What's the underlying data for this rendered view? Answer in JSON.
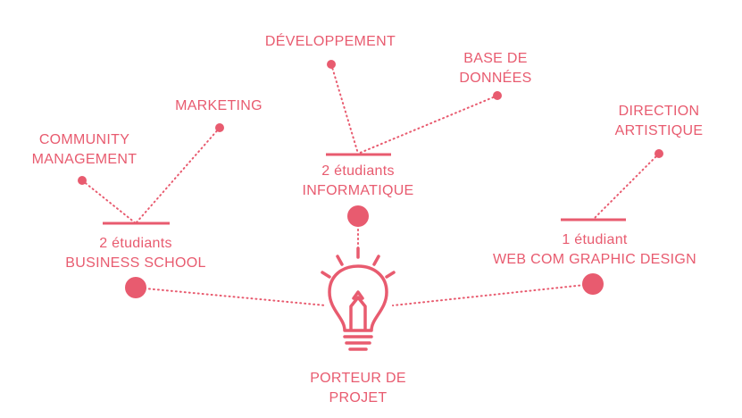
{
  "colors": {
    "accent": "#e85b6f"
  },
  "topics": {
    "developpement": "DÉVELOPPEMENT",
    "base_de_donnees": [
      "BASE DE",
      "DONNÉES"
    ],
    "marketing": "MARKETING",
    "community_management": [
      "COMMUNITY",
      "MANAGEMENT"
    ],
    "direction_artistique": [
      "DIRECTION",
      "ARTISTIQUE"
    ]
  },
  "groups": {
    "informatique": [
      "2 étudiants",
      "INFORMATIQUE"
    ],
    "business": [
      "2 étudiants",
      "BUSINESS SCHOOL"
    ],
    "webcom": [
      "1 étudiant",
      "WEB COM GRAPHIC DESIGN"
    ]
  },
  "center": {
    "label": [
      "PORTEUR DE",
      "PROJET"
    ],
    "icon": "lightbulb-icon"
  }
}
